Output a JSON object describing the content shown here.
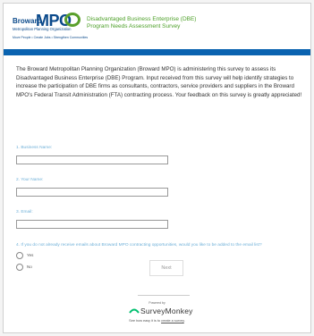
{
  "header": {
    "logo_word": "Broward",
    "logo_sub": "Metropolitan Planning Organization",
    "logo_mpo": "MPO",
    "logo_tag": "Move People • Create Jobs • Strengthen Communities",
    "title_line1": "Disadvantaged Business Enterprise (DBE)",
    "title_line2": "Program Needs Assessment Survey"
  },
  "intro": "The Broward Metropolitan Planning Organization (Broward MPO) is administering this survey to assess its Disadvantaged Business Enterprise (DBE) Program. Input received from this survey will help identify strategies to increase the participation of DBE firms as consultants, contractors, service providers and suppliers in the Broward MPO's Federal Transit Administration (FTA) contracting process. Your feedback on this survey is greatly appreciated!",
  "questions": [
    {
      "label": "1. Business Name:",
      "value": ""
    },
    {
      "label": "2. Your Name:",
      "value": ""
    },
    {
      "label": "3. Email:",
      "value": ""
    }
  ],
  "q4": {
    "label": "4. If you do not already receive emails about Broward MPO contracting opportunities, would you like to be added to the email list?",
    "options": [
      "Yes",
      "No"
    ]
  },
  "next_label": "Next",
  "footer": {
    "powered_by": "Powered by",
    "brand": "SurveyMonkey",
    "tagline_prefix": "See how easy it is to",
    "tagline_link": "create a survey",
    "tagline_suffix": "."
  },
  "colors": {
    "accent_blue": "#0a63b0",
    "title_green": "#4ea02a",
    "label_blue": "#6fb0d8"
  }
}
